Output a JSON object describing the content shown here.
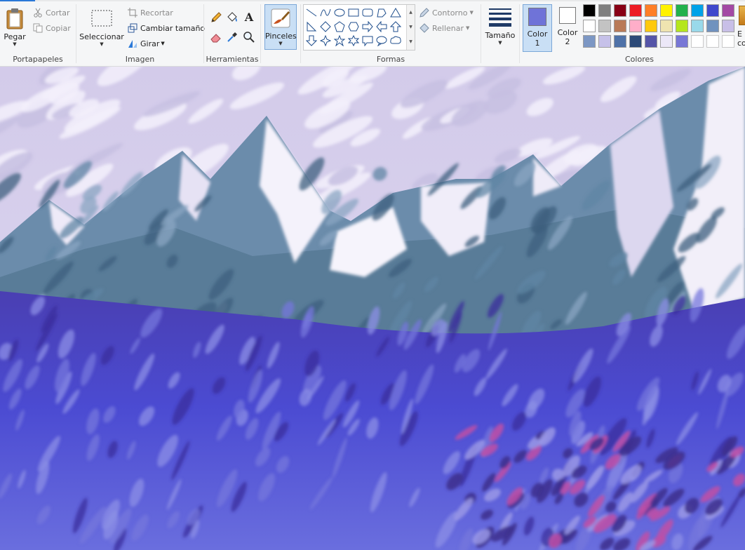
{
  "ribbon": {
    "clipboard": {
      "paste": "Pegar",
      "cut": "Cortar",
      "copy": "Copiar",
      "label": "Portapapeles"
    },
    "image": {
      "select": "Seleccionar",
      "crop": "Recortar",
      "resize": "Cambiar tamaño",
      "rotate": "Girar",
      "label": "Imagen"
    },
    "tools": {
      "label": "Herramientas",
      "text_icon": "A"
    },
    "brushes": {
      "label": "Pinceles"
    },
    "shapes": {
      "outline": "Contorno",
      "fill": "Rellenar",
      "label": "Formas"
    },
    "size": {
      "label": "Tamaño"
    },
    "colors": {
      "color1_line1": "Color",
      "color1_line2": "1",
      "color2_line1": "Color",
      "color2_line2": "2",
      "label": "Colores",
      "edit_line1": "E",
      "edit_line2": "co",
      "color1_value": "#6f73d8",
      "color2_value": "#ffffff",
      "palette": [
        "#000000",
        "#7f7f7f",
        "#880015",
        "#ed1c24",
        "#ff7f27",
        "#fff200",
        "#22b14c",
        "#00a2e8",
        "#3f48cc",
        "#a349a4",
        "#ffffff",
        "#c3c3c3",
        "#b97a57",
        "#ffaec9",
        "#ffc90e",
        "#efe4b0",
        "#b5e61d",
        "#99d9ea",
        "#7092be",
        "#c8bfe7",
        "#7c97c4",
        "#c6c1e9",
        "#4f72a8",
        "#2c4a78",
        "#5555a8",
        "#ece8f8",
        "#7877d6",
        "",
        "",
        ""
      ]
    }
  },
  "canvas": {
    "subject": "painted-mountain-landscape",
    "colors": {
      "sky": "#d6cfe8",
      "snow": "#f3f0fb",
      "rock": "#5f86a4",
      "rock_dark": "#3e5f7d",
      "field": "#4b46c8",
      "field_light": "#7677dc",
      "flowers": "#c04fa6"
    }
  }
}
